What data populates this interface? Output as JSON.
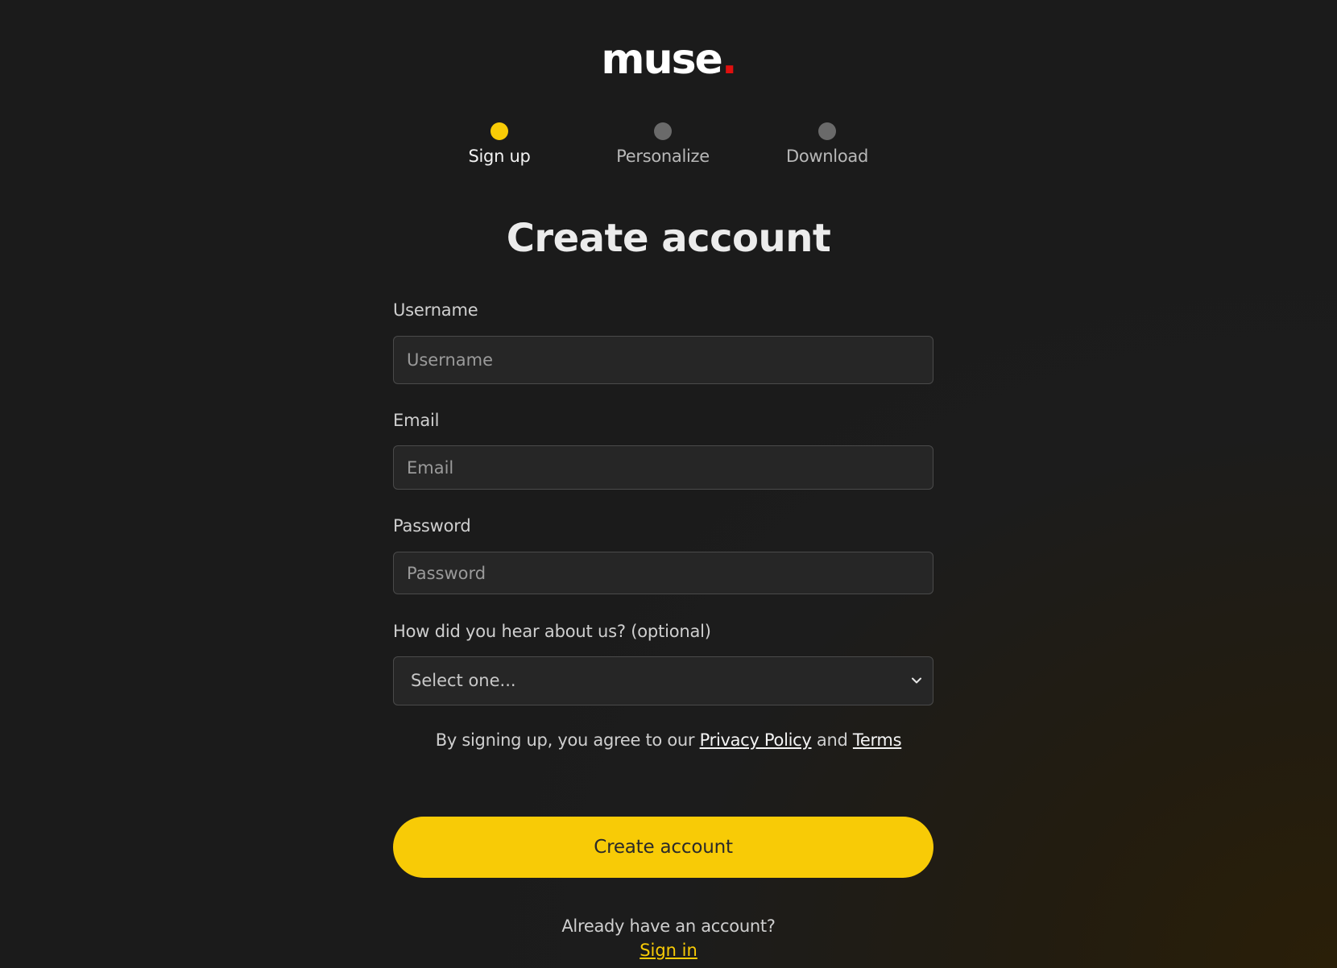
{
  "brand": {
    "name": "muse",
    "dot": ".",
    "dot_color": "#e0100f"
  },
  "steps": [
    {
      "label": "Sign up",
      "state": "active",
      "color": "#f8cb06"
    },
    {
      "label": "Personalize",
      "state": "inactive",
      "color": "#6a6a6a"
    },
    {
      "label": "Download",
      "state": "inactive",
      "color": "#6a6a6a"
    }
  ],
  "title": "Create account",
  "form": {
    "username": {
      "label": "Username",
      "placeholder": "Username",
      "value": ""
    },
    "email": {
      "label": "Email",
      "placeholder": "Email",
      "value": ""
    },
    "password": {
      "label": "Password",
      "placeholder": "Password",
      "value": ""
    },
    "referral": {
      "label": "How did you hear about us? (optional)",
      "selected": "Select one..."
    }
  },
  "consent": {
    "prefix": "By signing up, you agree to our ",
    "privacy_label": "Privacy Policy",
    "conjunction": " and ",
    "terms_label": "Terms"
  },
  "submit_label": "Create account",
  "signin": {
    "prompt": "Already have an account?",
    "link_label": "Sign in"
  },
  "colors": {
    "accent": "#f8cb06",
    "background": "#1b1b1b",
    "field_background": "#262626"
  }
}
